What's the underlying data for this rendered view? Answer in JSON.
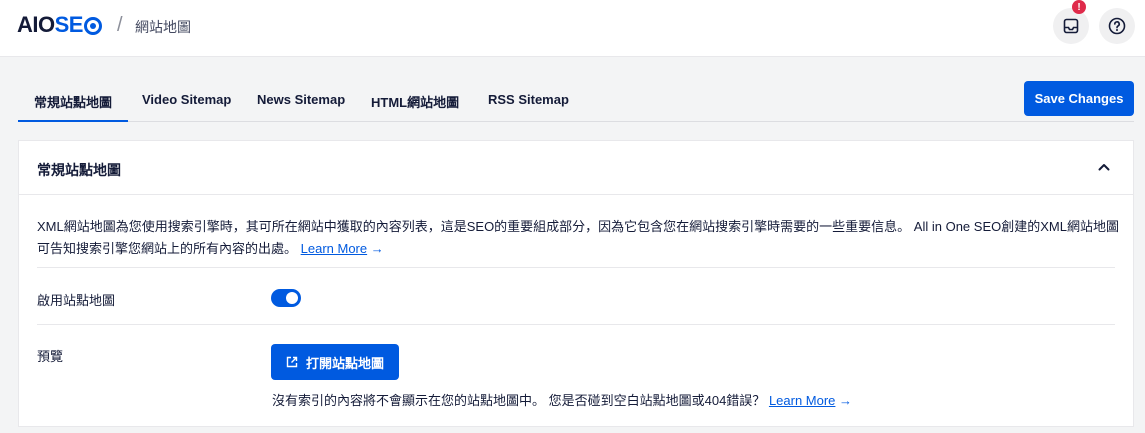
{
  "header": {
    "logo_aio": "AIO",
    "logo_seo": "SE",
    "separator": "/",
    "breadcrumb": "網站地圖",
    "notification_badge": "!",
    "icons": [
      "inbox-icon",
      "help-icon"
    ]
  },
  "tabs": [
    {
      "label": "常規站點地圖",
      "active": true
    },
    {
      "label": "Video Sitemap",
      "active": false
    },
    {
      "label": "News Sitemap",
      "active": false
    },
    {
      "label": "HTML網站地圖",
      "active": false
    },
    {
      "label": "RSS Sitemap",
      "active": false
    }
  ],
  "save_button": "Save Changes",
  "card": {
    "title": "常規站點地圖",
    "description": "XML網站地圖為您使用搜索引擎時，其可所在網站中獲取的內容列表，這是SEO的重要組成部分，因為它包含您在網站搜索引擎時需要的一些重要信息。 All in One SEO創建的XML網站地圖可告知搜索引擎您網站上的所有內容的出處。",
    "learn_more": "Learn More",
    "arrow": "→",
    "enable_label": "啟用站點地圖",
    "enable_value": true,
    "preview_label": "預覽",
    "open_button": "打開站點地圖",
    "note": "沒有索引的內容將不會顯示在您的站點地圖中。 您是否碰到空白站點地圖或404錯誤？",
    "note_link": "Learn More"
  },
  "colors": {
    "accent": "#005ae0",
    "badge": "#df2a4a",
    "text": "#141b38"
  }
}
